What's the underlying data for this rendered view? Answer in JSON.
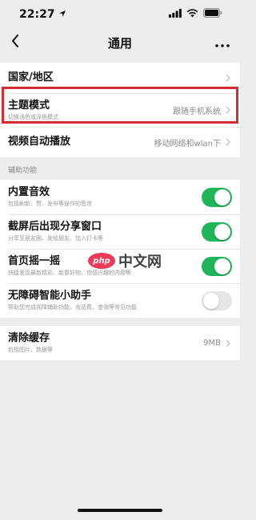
{
  "status_bar": {
    "time": "22:27",
    "icons": [
      "location-arrow-icon",
      "signal-icon",
      "wifi-icon",
      "battery-icon"
    ]
  },
  "nav": {
    "title": "通用",
    "back_icon": "chevron-left-icon",
    "more_icon": "more-dots-icon"
  },
  "group1": [
    {
      "title": "国家/地区"
    },
    {
      "title": "主题模式",
      "subtitle": "切换浅色或深色模式",
      "value": "跟随手机系统"
    },
    {
      "title": "视频自动播放",
      "value": "移动网络和wlan下"
    }
  ],
  "accessibility": {
    "section_label": "辅助功能",
    "items": [
      {
        "title": "内置音效",
        "subtitle": "包括刷新、赞、发布等操作的音效",
        "state": "on"
      },
      {
        "title": "截屏后出现分享窗口",
        "subtitle": "分享至朋友圈、发给朋友、加入打卡等",
        "state": "on"
      },
      {
        "title": "首页摇一摇",
        "subtitle": "快捷发现最新精彩、新春好物、你感兴趣的内容等",
        "state": "on"
      },
      {
        "title": "无障碍智能小助手",
        "subtitle": "帮助您完成视障辅助功能、充话费、查询等常见功能",
        "state": "off"
      }
    ]
  },
  "cache": {
    "title": "清除缓存",
    "subtitle": "包括图片、数据等",
    "value": "9MB"
  },
  "watermark": {
    "logo_text": "php",
    "text": "中文网"
  },
  "colors": {
    "toggle_on": "#1fb559",
    "highlight": "#d42b34",
    "background": "#ededed"
  }
}
